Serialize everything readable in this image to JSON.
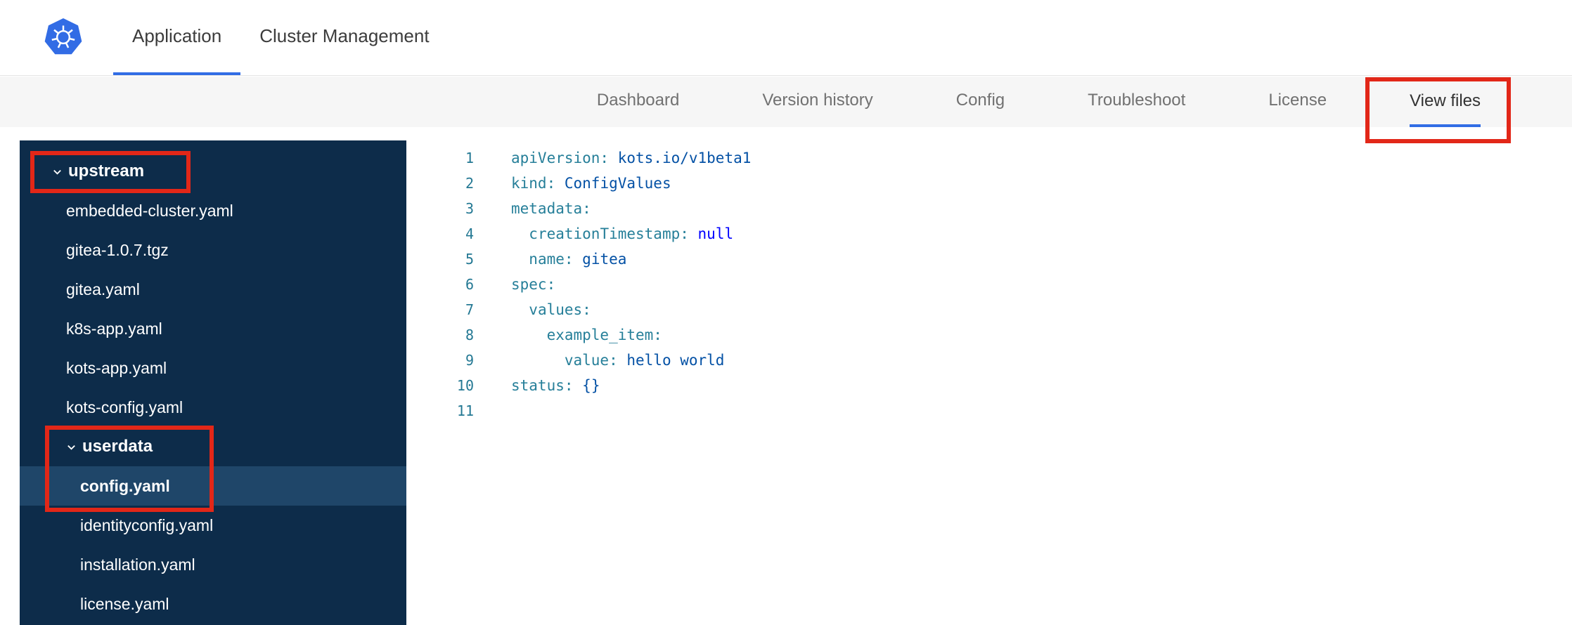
{
  "topnav": {
    "tabs": [
      {
        "label": "Application",
        "active": true
      },
      {
        "label": "Cluster Management",
        "active": false
      }
    ]
  },
  "subnav": {
    "tabs": [
      {
        "label": "Dashboard",
        "active": false
      },
      {
        "label": "Version history",
        "active": false
      },
      {
        "label": "Config",
        "active": false
      },
      {
        "label": "Troubleshoot",
        "active": false
      },
      {
        "label": "License",
        "active": false
      },
      {
        "label": "View files",
        "active": true
      }
    ]
  },
  "sidebar": {
    "tree": [
      {
        "type": "dir",
        "label": "upstream",
        "depth": 0,
        "expanded": true
      },
      {
        "type": "file",
        "label": "embedded-cluster.yaml",
        "depth": 1
      },
      {
        "type": "file",
        "label": "gitea-1.0.7.tgz",
        "depth": 1
      },
      {
        "type": "file",
        "label": "gitea.yaml",
        "depth": 1
      },
      {
        "type": "file",
        "label": "k8s-app.yaml",
        "depth": 1
      },
      {
        "type": "file",
        "label": "kots-app.yaml",
        "depth": 1
      },
      {
        "type": "file",
        "label": "kots-config.yaml",
        "depth": 1
      },
      {
        "type": "dir",
        "label": "userdata",
        "depth": 1,
        "expanded": true
      },
      {
        "type": "file",
        "label": "config.yaml",
        "depth": 2,
        "selected": true
      },
      {
        "type": "file",
        "label": "identityconfig.yaml",
        "depth": 2
      },
      {
        "type": "file",
        "label": "installation.yaml",
        "depth": 2
      },
      {
        "type": "file",
        "label": "license.yaml",
        "depth": 2
      }
    ]
  },
  "editor": {
    "lines": [
      {
        "n": 1,
        "tokens": [
          [
            "apiVersion:",
            "key"
          ],
          [
            " ",
            "plain"
          ],
          [
            "kots.io/v1beta1",
            "val"
          ]
        ]
      },
      {
        "n": 2,
        "tokens": [
          [
            "kind:",
            "key"
          ],
          [
            " ",
            "plain"
          ],
          [
            "ConfigValues",
            "val"
          ]
        ]
      },
      {
        "n": 3,
        "tokens": [
          [
            "metadata:",
            "key"
          ]
        ]
      },
      {
        "n": 4,
        "tokens": [
          [
            "  ",
            "plain"
          ],
          [
            "creationTimestamp:",
            "key"
          ],
          [
            " ",
            "plain"
          ],
          [
            "null",
            "kw"
          ]
        ]
      },
      {
        "n": 5,
        "tokens": [
          [
            "  ",
            "plain"
          ],
          [
            "name:",
            "key"
          ],
          [
            " ",
            "plain"
          ],
          [
            "gitea",
            "val"
          ]
        ]
      },
      {
        "n": 6,
        "tokens": [
          [
            "spec:",
            "key"
          ]
        ]
      },
      {
        "n": 7,
        "tokens": [
          [
            "  ",
            "plain"
          ],
          [
            "values:",
            "key"
          ]
        ]
      },
      {
        "n": 8,
        "tokens": [
          [
            "    ",
            "plain"
          ],
          [
            "example_item:",
            "key"
          ]
        ]
      },
      {
        "n": 9,
        "tokens": [
          [
            "      ",
            "plain"
          ],
          [
            "value:",
            "key"
          ],
          [
            " ",
            "plain"
          ],
          [
            "hello world",
            "val"
          ]
        ]
      },
      {
        "n": 10,
        "tokens": [
          [
            "status:",
            "key"
          ],
          [
            " ",
            "plain"
          ],
          [
            "{}",
            "val"
          ]
        ]
      },
      {
        "n": 11,
        "tokens": []
      }
    ]
  },
  "colors": {
    "accent": "#326de5",
    "annotation": "#e22718",
    "sidebar_bg": "#0d2c4a",
    "sidebar_selected_bg": "#1f4669",
    "yaml_key": "#267f99",
    "yaml_value": "#0451a5",
    "yaml_keyword": "#0000ff"
  },
  "icons": {
    "logo": "kubernetes-helm-wheel",
    "tree_expander": "chevron-down"
  }
}
